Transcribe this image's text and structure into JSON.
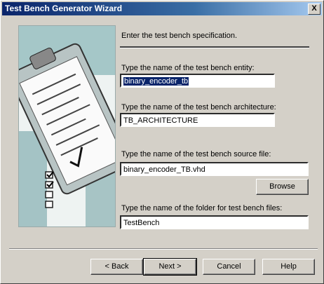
{
  "window": {
    "title": "Test Bench Generator Wizard",
    "close_glyph": "X"
  },
  "instruction": "Enter the test bench specification.",
  "fields": {
    "entity": {
      "label": "Type the name of the test bench entity:",
      "value": "binary_encoder_tb"
    },
    "architecture": {
      "label": "Type the name of the test bench architecture:",
      "value": "TB_ARCHITECTURE"
    },
    "source_file": {
      "label": "Type the name of the test bench source file:",
      "value": "binary_encoder_TB.vhd"
    },
    "folder": {
      "label": "Type the name of the folder for test bench files:",
      "value": "TestBench"
    }
  },
  "buttons": {
    "browse": "Browse",
    "back": "< Back",
    "next": "Next >",
    "cancel": "Cancel",
    "help": "Help"
  },
  "icons": {
    "close": "close-icon",
    "art": "clipboard-illustration"
  }
}
